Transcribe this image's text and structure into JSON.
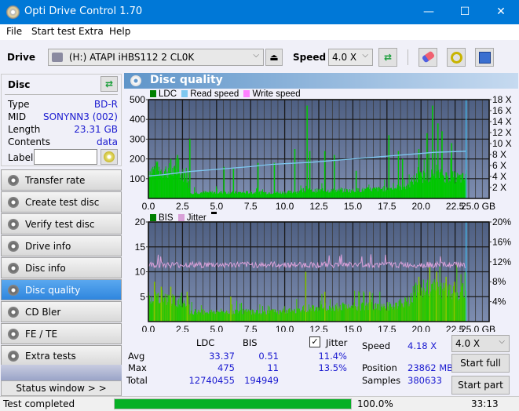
{
  "window": {
    "title": "Opti Drive Control 1.70",
    "minimize": "—",
    "maximize": "☐",
    "close": "✕"
  },
  "menu": [
    "File",
    "Start test",
    "Extra",
    "Help"
  ],
  "toolbar": {
    "drive_label": "Drive",
    "drive_value": "(H:)  ATAPI iHBS112  2 CL0K",
    "speed_label": "Speed",
    "speed_value": "4.0 X"
  },
  "disc": {
    "header": "Disc",
    "rows": [
      {
        "label": "Type",
        "value": "BD-R"
      },
      {
        "label": "MID",
        "value": "SONYNN3 (002)"
      },
      {
        "label": "Length",
        "value": "23.31 GB"
      },
      {
        "label": "Contents",
        "value": "data"
      }
    ],
    "label_field": "Label",
    "label_value": ""
  },
  "nav": [
    {
      "label": "Transfer rate",
      "active": false
    },
    {
      "label": "Create test disc",
      "active": false
    },
    {
      "label": "Verify test disc",
      "active": false
    },
    {
      "label": "Drive info",
      "active": false
    },
    {
      "label": "Disc info",
      "active": false
    },
    {
      "label": "Disc quality",
      "active": true
    },
    {
      "label": "CD Bler",
      "active": false
    },
    {
      "label": "FE / TE",
      "active": false
    },
    {
      "label": "Extra tests",
      "active": false
    }
  ],
  "status_window_btn": "Status window > >",
  "panel_title": "Disc quality",
  "colors": {
    "ldc": "#00c800",
    "bis": "#00c800",
    "read": "#7ec8f0",
    "write": "#ff80ff",
    "jitter": "#d8a0d8",
    "plot_bg_top": "#4e5f82",
    "plot_bg_bottom": "#7d8db0",
    "progress": "#06b025"
  },
  "chart_data": [
    {
      "type": "bar",
      "title": "LDC / Read speed",
      "legend": [
        "LDC",
        "Read speed",
        "Write speed"
      ],
      "xlabel": "GB",
      "x_ticks": [
        "0.0",
        "2.5",
        "5.0",
        "7.5",
        "10.0",
        "12.5",
        "15.0",
        "17.5",
        "20.0",
        "22.5",
        "25.0 GB"
      ],
      "xlim": [
        0,
        25
      ],
      "y_ticks": [
        "100",
        "200",
        "300",
        "400",
        "500"
      ],
      "ylim": [
        0,
        500
      ],
      "y2_ticks": [
        "2 X",
        "4 X",
        "6 X",
        "8 X",
        "10 X",
        "12 X",
        "14 X",
        "16 X",
        "18 X"
      ],
      "y2lim": [
        0,
        18
      ],
      "ldc_profile": [
        [
          0,
          140
        ],
        [
          0.5,
          150
        ],
        [
          1.0,
          140
        ],
        [
          1.5,
          140
        ],
        [
          2.0,
          130
        ],
        [
          2.5,
          120
        ],
        [
          2.9,
          110
        ],
        [
          3.0,
          30
        ],
        [
          5,
          30
        ],
        [
          7.5,
          30
        ],
        [
          10,
          30
        ],
        [
          12.5,
          40
        ],
        [
          15,
          40
        ],
        [
          17.5,
          50
        ],
        [
          19,
          60
        ],
        [
          19.5,
          100
        ],
        [
          20,
          110
        ],
        [
          21,
          120
        ],
        [
          22,
          110
        ],
        [
          23.3,
          100
        ]
      ],
      "ldc_spikes": [
        [
          0.6,
          180
        ],
        [
          1.6,
          200
        ],
        [
          2.1,
          220
        ],
        [
          3.0,
          300
        ],
        [
          5.5,
          160
        ],
        [
          6.2,
          150
        ],
        [
          8.0,
          180
        ],
        [
          9.2,
          180
        ],
        [
          10.7,
          250
        ],
        [
          11.6,
          470
        ],
        [
          11.8,
          240
        ],
        [
          12.9,
          240
        ],
        [
          13.6,
          220
        ],
        [
          15.2,
          140
        ],
        [
          17.6,
          320
        ],
        [
          18.3,
          240
        ],
        [
          18.6,
          200
        ],
        [
          19.8,
          250
        ],
        [
          20.4,
          330
        ],
        [
          20.8,
          470
        ],
        [
          21.2,
          380
        ],
        [
          21.5,
          340
        ],
        [
          22.2,
          280
        ]
      ],
      "read_speed": [
        [
          0,
          4.1
        ],
        [
          1,
          4.3
        ],
        [
          2,
          4.6
        ],
        [
          3,
          4.9
        ],
        [
          4.5,
          5.2
        ],
        [
          6,
          5.5
        ],
        [
          7.5,
          5.8
        ],
        [
          9,
          6.2
        ],
        [
          10.5,
          6.4
        ],
        [
          12,
          6.6
        ],
        [
          13.5,
          6.9
        ],
        [
          15,
          7.2
        ],
        [
          16.5,
          7.5
        ],
        [
          18,
          7.8
        ],
        [
          19.5,
          8.1
        ],
        [
          21,
          8.4
        ],
        [
          23.3,
          8.6
        ]
      ],
      "end_marker_gb": 23.31
    },
    {
      "type": "bar",
      "title": "BIS / Jitter",
      "legend": [
        "BIS",
        "Jitter"
      ],
      "xlabel": "GB",
      "x_ticks": [
        "0.0",
        "2.5",
        "5.0",
        "7.5",
        "10.0",
        "12.5",
        "15.0",
        "17.5",
        "20.0",
        "22.5",
        "25.0 GB"
      ],
      "xlim": [
        0,
        25
      ],
      "y_ticks": [
        "5",
        "10",
        "15",
        "20"
      ],
      "ylim": [
        0,
        20
      ],
      "y2_ticks": [
        "4%",
        "8%",
        "12%",
        "16%",
        "20%"
      ],
      "y2lim": [
        0,
        20
      ],
      "bis_profile": [
        [
          0,
          5
        ],
        [
          1,
          5
        ],
        [
          2,
          4
        ],
        [
          2.9,
          4
        ],
        [
          3.0,
          2
        ],
        [
          7.5,
          2
        ],
        [
          10,
          2
        ],
        [
          12.5,
          3
        ],
        [
          15,
          3
        ],
        [
          17.5,
          3
        ],
        [
          19,
          4
        ],
        [
          19.5,
          6
        ],
        [
          20.5,
          7
        ],
        [
          22,
          6
        ],
        [
          23.3,
          6
        ]
      ],
      "bis_spikes": [
        [
          0.4,
          8
        ],
        [
          0.9,
          7
        ],
        [
          1.6,
          7
        ],
        [
          2.8,
          6
        ],
        [
          6,
          5
        ],
        [
          11.5,
          10
        ],
        [
          12.9,
          6
        ],
        [
          16.2,
          6
        ],
        [
          19.8,
          9
        ],
        [
          20.6,
          11
        ],
        [
          21.1,
          10
        ],
        [
          21.8,
          9
        ],
        [
          22.4,
          8
        ]
      ],
      "jitter_avg_pct": 11.4,
      "jitter_max_pct": 13.5,
      "end_marker_gb": 23.31
    }
  ],
  "stats": {
    "col_ldc": "LDC",
    "col_bis": "BIS",
    "jitter_label": "Jitter",
    "jitter_checked": true,
    "rows": [
      {
        "label": "Avg",
        "ldc": "33.37",
        "bis": "0.51",
        "jitter": "11.4%"
      },
      {
        "label": "Max",
        "ldc": "475",
        "bis": "11",
        "jitter": "13.5%"
      },
      {
        "label": "Total",
        "ldc": "12740455",
        "bis": "194949",
        "jitter": ""
      }
    ],
    "speed_label": "Speed",
    "speed_value": "4.18 X",
    "position_label": "Position",
    "position_value": "23862 MB",
    "samples_label": "Samples",
    "samples_value": "380633",
    "speed_select": "4.0 X",
    "start_full": "Start full",
    "start_part": "Start part"
  },
  "statusbar": {
    "text": "Test completed",
    "progress_pct": 100,
    "progress_text": "100.0%",
    "time": "33:13"
  }
}
